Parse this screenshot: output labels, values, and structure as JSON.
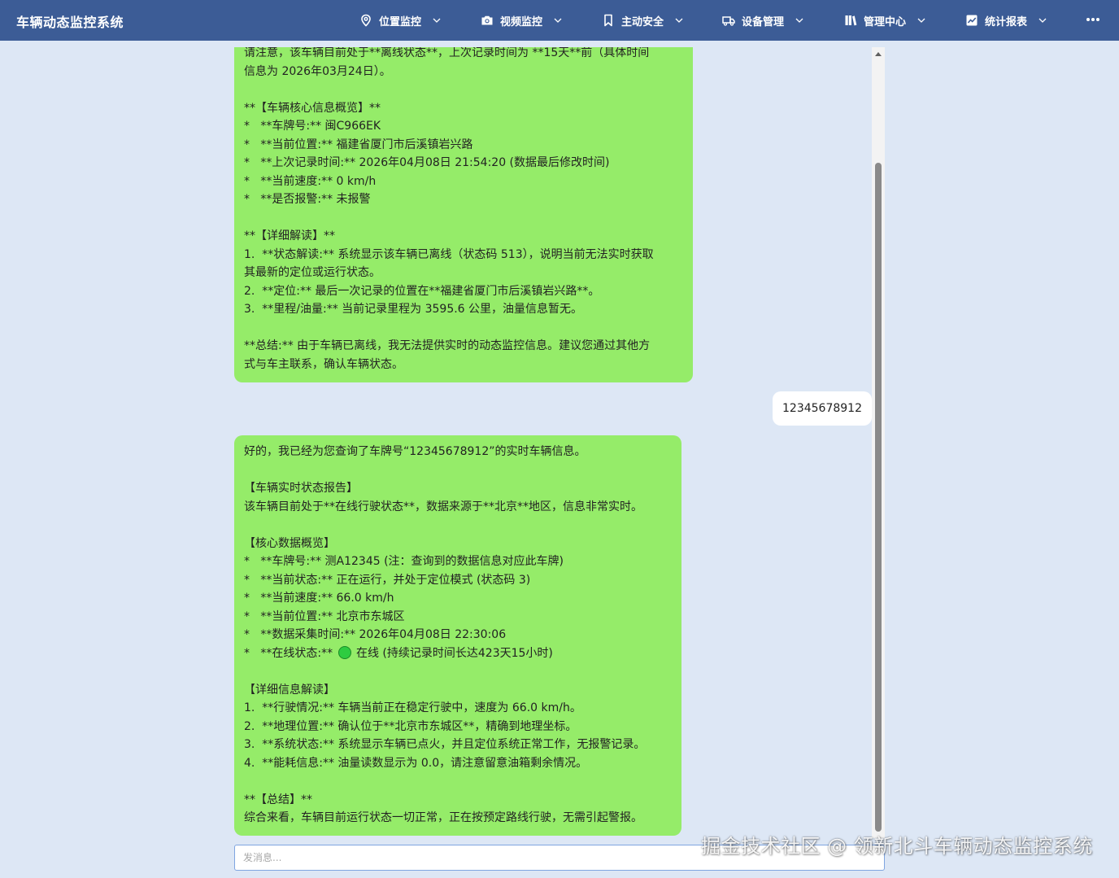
{
  "header": {
    "app_title": "车辆动态监控系统",
    "nav": [
      {
        "label": "位置监控",
        "icon": "location-pin-icon"
      },
      {
        "label": "视频监控",
        "icon": "camera-icon"
      },
      {
        "label": "主动安全",
        "icon": "bookmark-icon"
      },
      {
        "label": "设备管理",
        "icon": "truck-icon"
      },
      {
        "label": "管理中心",
        "icon": "books-icon"
      },
      {
        "label": "统计报表",
        "icon": "chart-icon"
      }
    ],
    "more_icon": "more-dots-icon"
  },
  "chat": {
    "message_1": {
      "sender": "bot",
      "lines": [
        "请注意，该车辆目前处于**离线状态**，上次记录时间为 **15天**前（具体时间",
        "信息为 2026年03月24日）。",
        "",
        "**【车辆核心信息概览】**",
        "*   **车牌号:** 闽C966EK",
        "*   **当前位置:** 福建省厦门市后溪镇岩兴路",
        "*   **上次记录时间:** 2026年04月08日 21:54:20 (数据最后修改时间)",
        "*   **当前速度:** 0 km/h",
        "*   **是否报警:** 未报警",
        "",
        "**【详细解读】**",
        "1.  **状态解读:** 系统显示该车辆已离线（状态码 513），说明当前无法实时获取",
        "其最新的定位或运行状态。",
        "2.  **定位:** 最后一次记录的位置在**福建省厦门市后溪镇岩兴路**。",
        "3.  **里程/油量:** 当前记录里程为 3595.6 公里，油量信息暂无。",
        "",
        "**总结:** 由于车辆已离线，我无法提供实时的动态监控信息。建议您通过其他方",
        "式与车主联系，确认车辆状态。"
      ]
    },
    "user_message": "12345678912",
    "message_2": {
      "sender": "bot",
      "lines": [
        "好的，我已经为您查询了车牌号“12345678912”的实时车辆信息。",
        "",
        "【车辆实时状态报告】",
        "该车辆目前处于**在线行驶状态**，数据来源于**北京**地区，信息非常实时。",
        "",
        "【核心数据概览】",
        "*   **车牌号:** 测A12345 (注：查询到的数据信息对应此车牌)",
        "*   **当前状态:** 正在运行，并处于定位模式 (状态码 3)",
        "*   **当前速度:** 66.0 km/h",
        "*   **当前位置:** 北京市东城区",
        "*   **数据采集时间:** 2026年04月08日 22:30:06",
        "",
        "",
        "【详细信息解读】",
        "1.  **行驶情况:** 车辆当前正在稳定行驶中，速度为 66.0 km/h。",
        "2.  **地理位置:** 确认位于**北京市东城区**，精确到地理坐标。",
        "3.  **系统状态:** 系统显示车辆已点火，并且定位系统正常工作，无报警记录。",
        "4.  **能耗信息:** 油量读数显示为 0.0，请注意留意油箱剩余情况。",
        "",
        "**【总结】**",
        "综合来看，车辆目前运行状态一切正常，正在按预定路线行驶，无需引起警报。"
      ],
      "online_line_prefix": "*   **在线状态:** ",
      "online_line_suffix": " 在线 (持续记录时间长达423天15小时)",
      "online_dot_color": "#2ecc40"
    }
  },
  "input": {
    "placeholder": "发消息..."
  },
  "watermark": "掘金技术社区 @ 领新北斗车辆动态监控系统",
  "colors": {
    "header_bg": "#3c5c96",
    "page_bg": "#dde7f5",
    "bot_bubble": "#95ec69",
    "user_bubble": "#ffffff"
  }
}
